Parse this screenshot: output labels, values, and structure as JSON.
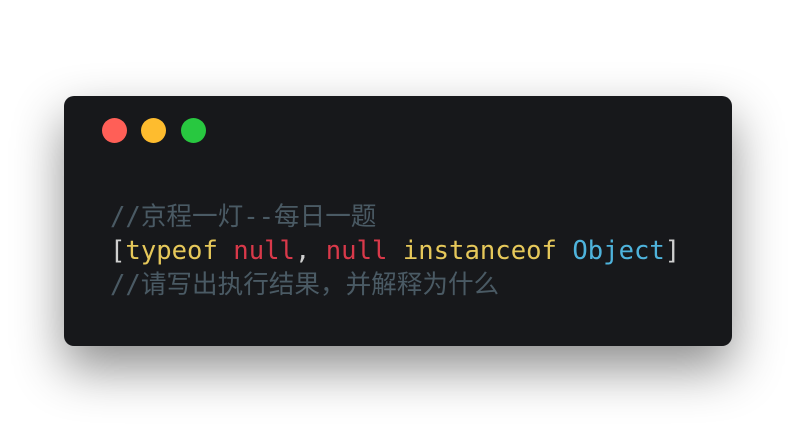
{
  "window": {
    "buttons": [
      "close",
      "minimize",
      "maximize"
    ],
    "colors": {
      "close": "#ff5f57",
      "minimize": "#febc2e",
      "maximize": "#28c840",
      "background": "#17181b"
    }
  },
  "code": {
    "line1": "//京程一灯--每日一题",
    "line2": {
      "open_bracket": "[",
      "t1": "typeof",
      "sp1": " ",
      "t2": "null",
      "comma": ", ",
      "t3": "null",
      "sp2": " ",
      "t4": "instanceof",
      "sp3": " ",
      "t5": "Object",
      "close_bracket": "]"
    },
    "line3": "//请写出执行结果，并解释为什么"
  }
}
